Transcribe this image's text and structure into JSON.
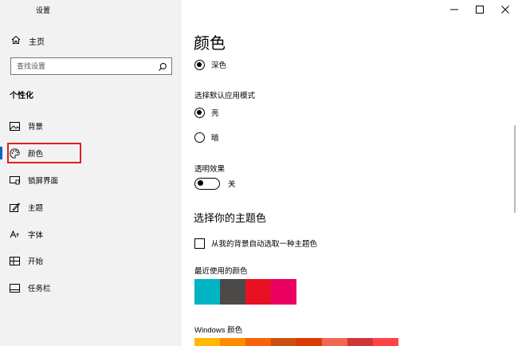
{
  "window": {
    "title": "设置",
    "minimize_glyph": "—",
    "maximize_glyph": "☐",
    "close_glyph": "✕"
  },
  "sidebar": {
    "back_glyph": "←",
    "home_label": "主页",
    "search_placeholder": "查找设置",
    "section_title": "个性化",
    "items": [
      {
        "label": "背景",
        "icon": "picture-icon"
      },
      {
        "label": "颜色",
        "icon": "palette-icon",
        "selected": true
      },
      {
        "label": "锁屏界面",
        "icon": "lock-screen-icon"
      },
      {
        "label": "主题",
        "icon": "theme-icon"
      },
      {
        "label": "字体",
        "icon": "font-icon"
      },
      {
        "label": "开始",
        "icon": "start-icon"
      },
      {
        "label": "任务栏",
        "icon": "taskbar-icon"
      }
    ]
  },
  "main": {
    "title": "颜色",
    "mode_option_dark": "深色",
    "app_mode_label": "选择默认应用模式",
    "app_mode_light": "亮",
    "app_mode_dark": "暗",
    "transparency_label": "透明效果",
    "transparency_state": "关",
    "accent_heading": "选择你的主题色",
    "auto_accent_label": "从我的背景自动选取一种主题色",
    "recent_colors_label": "最近使用的颜色",
    "recent_colors": [
      "#00b4c4",
      "#4c4a48",
      "#e81123",
      "#ea005e"
    ],
    "windows_colors_label": "Windows 颜色",
    "windows_colors": [
      "#ffb900",
      "#ff8c00",
      "#f7630c",
      "#ca5010",
      "#da3b01",
      "#ef6950",
      "#d13438",
      "#ff4343"
    ]
  },
  "colors": {
    "accent": "#0067c0",
    "highlight": "#e02020",
    "sidebar_bg": "#f2f2f2"
  }
}
